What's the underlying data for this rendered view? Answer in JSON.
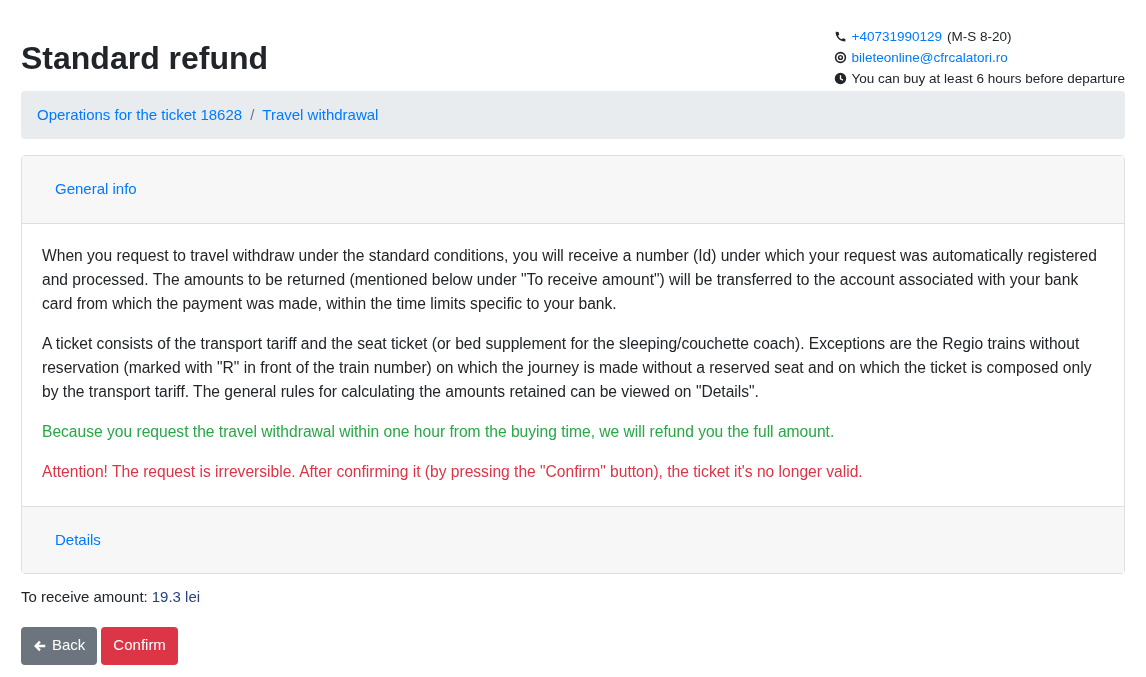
{
  "title": "Standard refund",
  "contacts": [
    {
      "kind": "phone",
      "link": "+40731990129",
      "text": "(M-S 8-20)"
    },
    {
      "kind": "email",
      "link": "bileteonline@cfrcalatori.ro"
    },
    {
      "kind": "clock",
      "text": "You can buy at least 6 hours before departure"
    }
  ],
  "breadcrumb": [
    "Operations for the ticket 18628",
    "Travel withdrawal"
  ],
  "breadcrumb_separator": "/",
  "card": {
    "header": "General info",
    "paragraphs": [
      {
        "kind": "normal",
        "text": "When you request to travel withdraw under the standard conditions, you will receive a number (Id) under which your request was automatically registered and processed. The amounts to be returned (mentioned below under \"To receive amount\") will be transferred to the account associated with your bank card from which the payment was made, within the time limits specific to your bank."
      },
      {
        "kind": "normal",
        "text": "A ticket consists of the transport tariff and the seat ticket (or bed supplement for the sleeping/couchette coach). Exceptions are the Regio trains without reservation (marked with \"R\" in front of the train number) on which the journey is made without a reserved seat and on which the ticket is composed only by the transport tariff. The general rules for calculating the amounts retained can be viewed on \"Details\"."
      },
      {
        "kind": "success",
        "text": "Because you request the travel withdrawal within one hour from the buying time, we will refund you the full amount."
      },
      {
        "kind": "danger",
        "text": "Attention! The request is irreversible. After confirming it (by pressing the \"Confirm\" button), the ticket it's no longer valid."
      }
    ],
    "footer": "Details"
  },
  "amount": {
    "label": "To receive amount:",
    "value": "19.3 lei"
  },
  "buttons": [
    {
      "kind": "back",
      "label": "Back"
    },
    {
      "kind": "confirm",
      "label": "Confirm"
    }
  ]
}
